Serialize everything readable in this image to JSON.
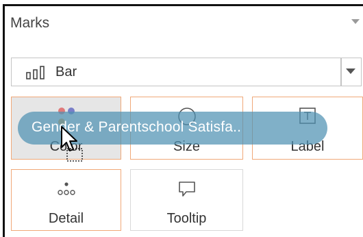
{
  "marks": {
    "title": "Marks",
    "mark_type": {
      "label": "Bar",
      "icon": "bar-chart-icon"
    },
    "cards": {
      "color": {
        "label": "Color",
        "icon": "color-dots-icon"
      },
      "size": {
        "label": "Size",
        "icon": "size-circle-icon"
      },
      "label": {
        "label": "Label",
        "icon": "text-label-icon"
      },
      "detail": {
        "label": "Detail",
        "icon": "detail-dots-icon"
      },
      "tooltip": {
        "label": "Tooltip",
        "icon": "speech-bubble-icon"
      }
    },
    "drag_pill": {
      "text": "Gender & Parentschool Satisfa.."
    }
  },
  "colors": {
    "card_border": "#f0a878",
    "pill": "#4f92b3",
    "color_dot_red": "#e07a7a",
    "color_dot_blue": "#7a7fc8",
    "color_dot_orange": "#e8a44a"
  }
}
